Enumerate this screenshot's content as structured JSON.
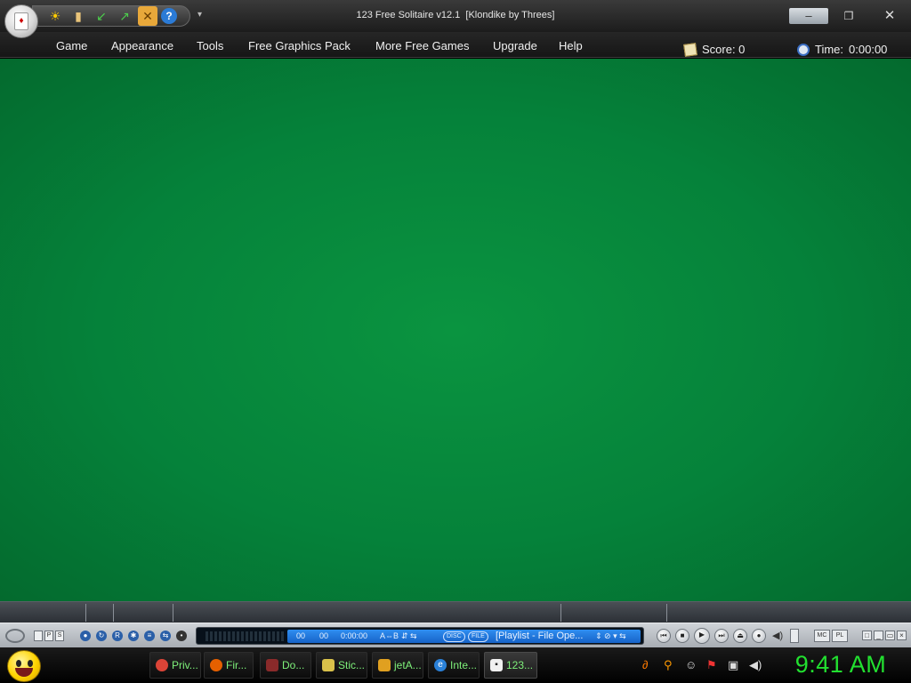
{
  "titlebar": {
    "title": "123 Free Solitaire v12.1  [Klondike by Threes]",
    "minimize_label": "–",
    "maximize_label": "❐",
    "close_label": "✕",
    "dropdown_glyph": "▾",
    "quick_icons": [
      "sun-icon",
      "book-icon",
      "undo-arrow-icon",
      "redo-arrow-icon",
      "tools-icon",
      "help-icon"
    ]
  },
  "menu": {
    "items": [
      "Game",
      "Appearance",
      "Tools",
      "Free Graphics Pack",
      "More Free Games",
      "Upgrade",
      "Help"
    ]
  },
  "status": {
    "score_label": "Score: 0",
    "time_label": "Time:",
    "time_value": "0:00:00"
  },
  "player": {
    "small_labels": [
      "P",
      "S"
    ],
    "time_a": "00",
    "time_b": "00",
    "time_c": "0:00:00",
    "ab_label": "A⇔B",
    "disc_label": "DISC",
    "file_label": "FILE",
    "playlist_text": "[Playlist - File Ope...",
    "mc_label": "MC",
    "pl_label": "PL"
  },
  "taskbar": {
    "tasks": [
      {
        "label": "Priv...",
        "icon": "chrome-icon",
        "color": "#db4437"
      },
      {
        "label": "Fir...",
        "icon": "firefox-icon",
        "color": "#e66000"
      },
      {
        "label": "Do...",
        "icon": "download-icon",
        "color": "#8a2a2a"
      },
      {
        "label": "Stic...",
        "icon": "sticky-notes-icon",
        "color": "#d9c14a"
      },
      {
        "label": "jetA...",
        "icon": "jetaudio-icon",
        "color": "#e0a020"
      },
      {
        "label": "Inte...",
        "icon": "internet-explorer-icon",
        "color": "#2a80d8"
      },
      {
        "label": "123...",
        "icon": "solitaire-icon",
        "color": "#f0f0f0"
      }
    ],
    "clock": "9:41 AM"
  },
  "colors": {
    "felt": "#058a3c",
    "clock": "#22e030",
    "task_text": "#7ef07a"
  }
}
